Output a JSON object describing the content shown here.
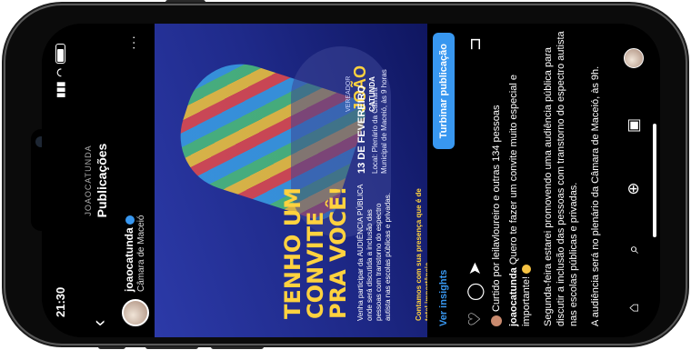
{
  "status": {
    "time": "21:30"
  },
  "header": {
    "account": "JOAOCATUNDA",
    "title": "Publicações",
    "back_icon": "‹"
  },
  "account": {
    "username": "joaocatunda",
    "location": "Câmara de Maceió",
    "more": "···"
  },
  "post_image": {
    "headline": "TENHO UM CONVITE PRA VOCÊ!",
    "body": "Venha participar da AUDIÊNCIA PÚBLICA onde será discutida a inclusão das pessoas com transtorno do espectro autista nas escolas públicas e privadas.",
    "call": "Contamos com sua presença que é de total importância.",
    "date": "13 DE FEVEREIRO",
    "place": "Local: Plenário da Câmara Municipal de Maceió, às 9 horas",
    "logo_small": "VEREADOR",
    "logo_big": "JOÃO",
    "logo_sub": "CATUNDA"
  },
  "insights": {
    "link": "Ver insights",
    "boost": "Turbinar publicação"
  },
  "likes": "Curtido por leilavloureiro e outras 134 pessoas",
  "caption": {
    "user": "joaocatunda",
    "text": "Quero te fazer um convite muito especial e importante!",
    "p2": "Segunda-feira estarei promovendo uma audiência pública para discutir a inclusão das pessoas com transtorno do espectro autista nas escolas públicas e privadas.",
    "p3": "A audiência será no plenário da Câmara de Maceió, às 9h."
  },
  "nav": [
    "⌂",
    "⌕",
    "⊕",
    "▣"
  ]
}
